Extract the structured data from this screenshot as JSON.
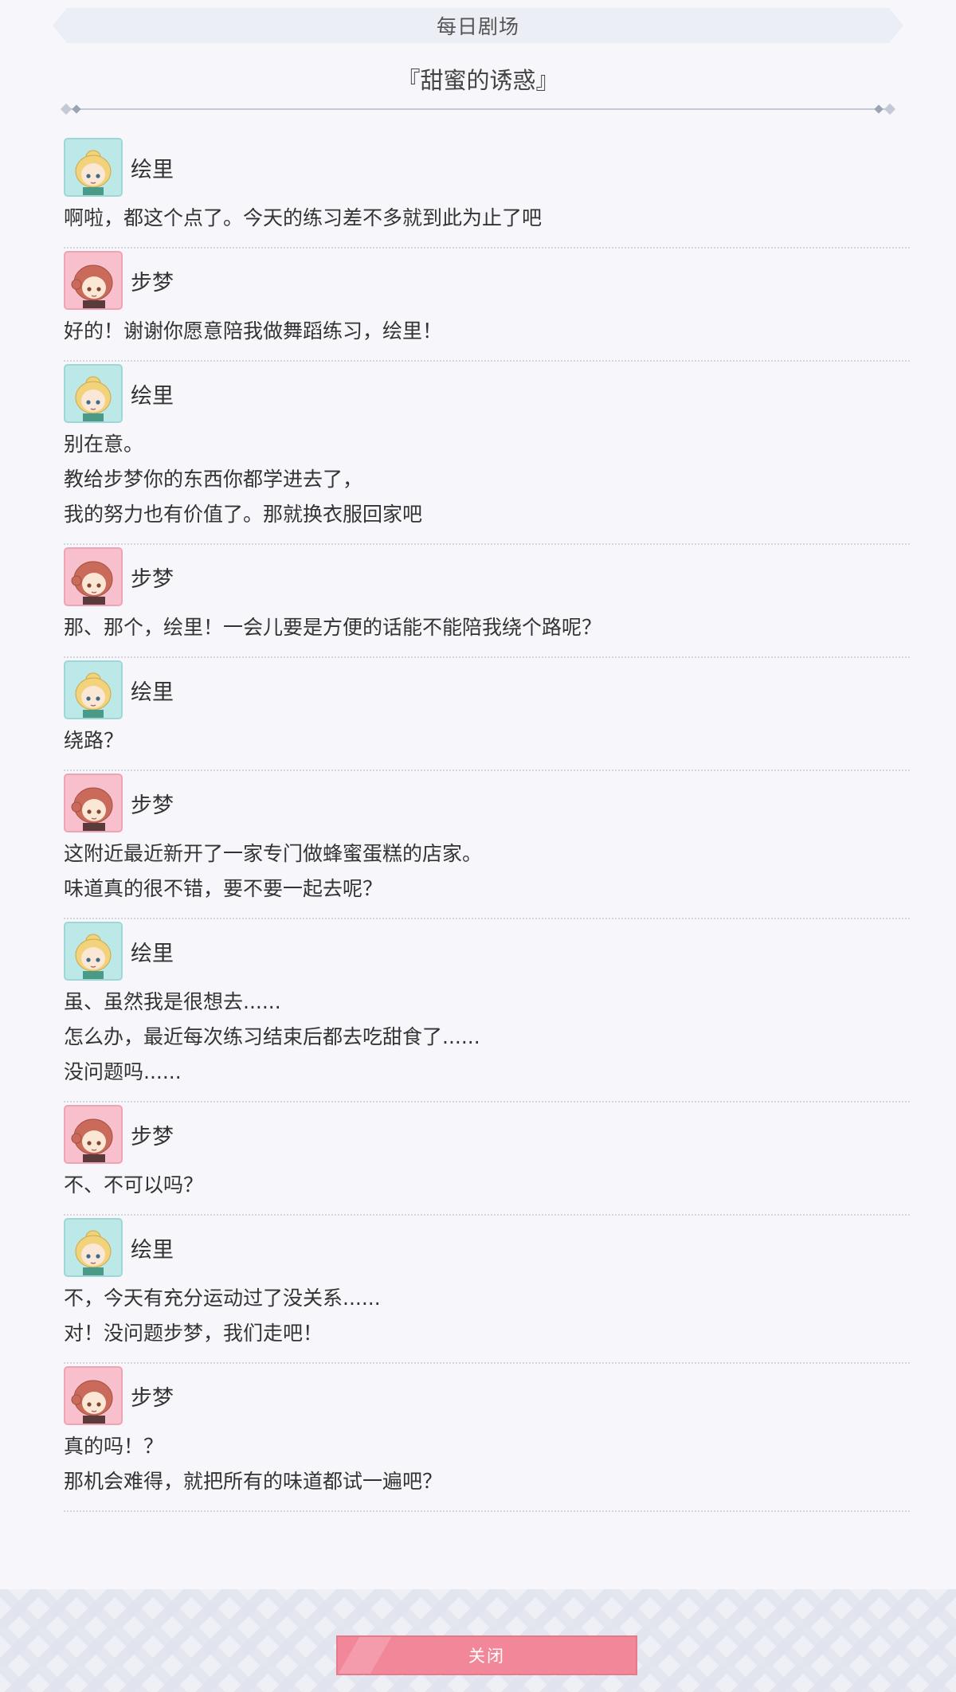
{
  "header": {
    "title": "每日剧场"
  },
  "story": {
    "title": "『甜蜜的诱惑』"
  },
  "dialog": [
    {
      "speaker": "绘里",
      "avatar": "eli",
      "lines": [
        "啊啦，都这个点了。今天的练习差不多就到此为止了吧"
      ]
    },
    {
      "speaker": "步梦",
      "avatar": "ayumu",
      "lines": [
        "好的！谢谢你愿意陪我做舞蹈练习，绘里！"
      ]
    },
    {
      "speaker": "绘里",
      "avatar": "eli",
      "lines": [
        "别在意。",
        "教给步梦你的东西你都学进去了，",
        "我的努力也有价值了。那就换衣服回家吧"
      ]
    },
    {
      "speaker": "步梦",
      "avatar": "ayumu",
      "lines": [
        "那、那个，绘里！一会儿要是方便的话能不能陪我绕个路呢？"
      ]
    },
    {
      "speaker": "绘里",
      "avatar": "eli",
      "lines": [
        "绕路？"
      ]
    },
    {
      "speaker": "步梦",
      "avatar": "ayumu",
      "lines": [
        "这附近最近新开了一家专门做蜂蜜蛋糕的店家。",
        "味道真的很不错，要不要一起去呢？"
      ]
    },
    {
      "speaker": "绘里",
      "avatar": "eli",
      "lines": [
        "虽、虽然我是很想去......",
        "怎么办，最近每次练习结束后都去吃甜食了......",
        "没问题吗......"
      ]
    },
    {
      "speaker": "步梦",
      "avatar": "ayumu",
      "lines": [
        "不、不可以吗？"
      ]
    },
    {
      "speaker": "绘里",
      "avatar": "eli",
      "lines": [
        "不，今天有充分运动过了没关系......",
        "对！没问题步梦，我们走吧！"
      ]
    },
    {
      "speaker": "步梦",
      "avatar": "ayumu",
      "lines": [
        "真的吗！？",
        "那机会难得，就把所有的味道都试一遍吧？"
      ]
    }
  ],
  "footer": {
    "close_label": "关闭"
  },
  "colors": {
    "accent": "#f2879a",
    "eli_bg": "#bde8e8",
    "ayumu_bg": "#f7c0cc"
  }
}
